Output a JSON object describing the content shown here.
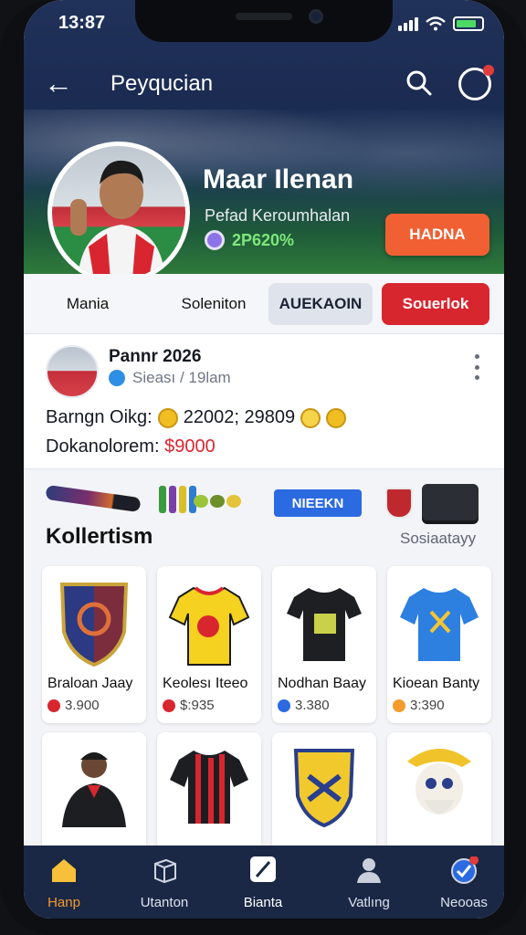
{
  "status": {
    "time": "13:87"
  },
  "header": {
    "title": "Peyqucian"
  },
  "profile": {
    "name": "Maar Ilenan",
    "subtitle": "Pefad Keroumhalan",
    "score": "2P620%",
    "action_label": "HADNA"
  },
  "tabs": [
    "Mania",
    "Soleniton",
    "AUEKAOIN",
    "Souerlok"
  ],
  "card": {
    "title": "Pannr 2026",
    "handle": "Sieası / 19lam",
    "line1_label": "Barngn Oikg:",
    "line1_value": "22002; 29809",
    "line2_label": "Dokanolorem:",
    "line2_value": "$9000"
  },
  "ribbon": {
    "button_label": "NIEEKN"
  },
  "collection": {
    "title": "Kollertism",
    "link": "Sosiaatayy",
    "items": [
      {
        "name": "Braloan Jaay",
        "price": "3.900",
        "color": "#d8262f"
      },
      {
        "name": "Keolesı Iteeo",
        "price": "$:935",
        "color": "#d8262f"
      },
      {
        "name": "Nodhan Baay",
        "price": "3.380",
        "color": "#2b6ae0"
      },
      {
        "name": "Kioean Banty",
        "price": "3:390",
        "color": "#f39b2d"
      }
    ]
  },
  "nav": [
    {
      "label": "Hanp",
      "icon": "home-icon"
    },
    {
      "label": "Utanton",
      "icon": "cube-icon"
    },
    {
      "label": "Bianta",
      "icon": "pen-icon"
    },
    {
      "label": "Vatlıng",
      "icon": "person-icon"
    },
    {
      "label": "Neooas",
      "icon": "check-badge-icon"
    }
  ],
  "colors": {
    "accent_red": "#d8262f",
    "accent_orange": "#f06033",
    "nav_bg": "#1a2846",
    "active": "#f39b2d"
  }
}
